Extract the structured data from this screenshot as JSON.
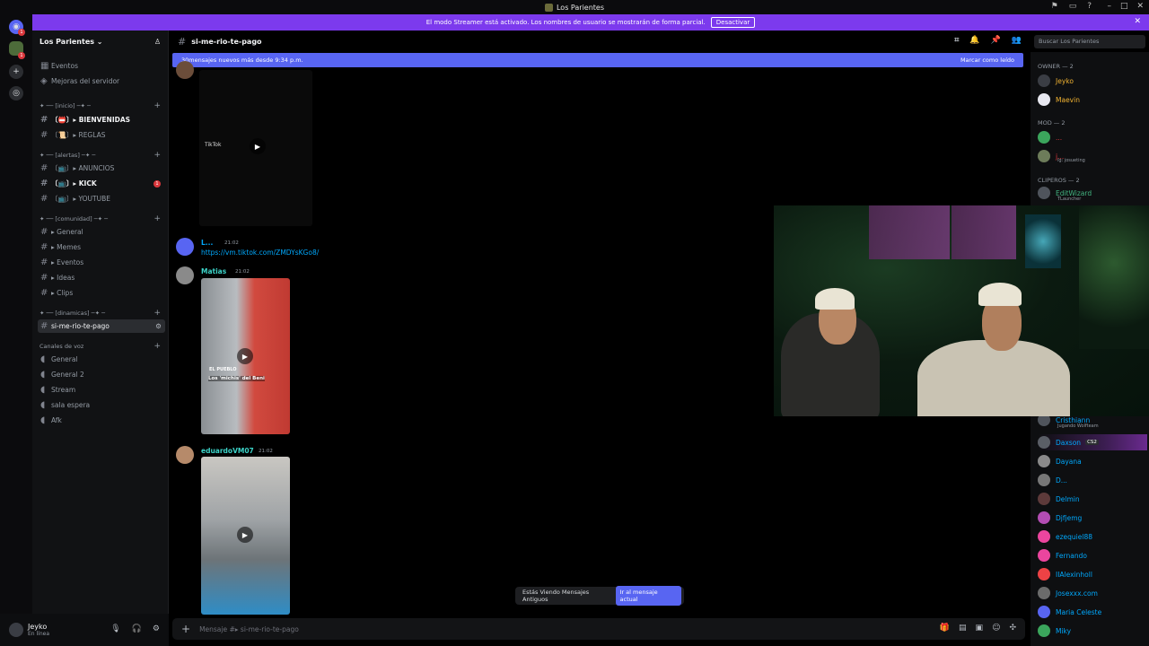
{
  "window": {
    "title": "Los Parientes"
  },
  "banner": {
    "text": "El modo Streamer está activado. Los nombres de usuario se mostrarán de forma parcial.",
    "button": "Desactivar"
  },
  "server": {
    "name": "Los Parientes"
  },
  "channels": {
    "top": [
      "Eventos",
      "Mejoras del servidor"
    ],
    "cat_inicio": "✦ ── [inicio] ─✦ ─",
    "inicio": [
      "〔📛〕▸ BIENVENIDAS",
      "〔📜〕▸ REGLAS"
    ],
    "cat_alertas": "✦ ── [alertas] ─✦ ─",
    "alertas": [
      "〔📺〕▸ ANUNCIOS",
      "〔📺〕▸ KICK",
      "〔📺〕▸ YOUTUBE"
    ],
    "kick_badge": "1",
    "cat_comunidad": "✦ ── [comunidad] ─✦ ─",
    "comunidad": [
      "▸ General",
      "▸ Memes",
      "▸ Eventos",
      "▸ Ideas",
      "▸ Clips"
    ],
    "cat_dinamicas": "✦ ── [dinamicas] ─✦ ─",
    "active": "si-me-rio-te-pago",
    "voice_cat": "Canales de voz",
    "voice": [
      "General",
      "General 2",
      "Stream",
      "sala espera",
      "Afk"
    ]
  },
  "user": {
    "name": "Jeyko",
    "status": "En línea"
  },
  "chat": {
    "channel": "si-me-rio-te-pago",
    "newmsg": "30mensajes nuevos más desde 9:34 p.m.",
    "mark_read": "Marcar como leído",
    "msg1": {
      "name": "L...",
      "time": "21:02",
      "link": "https://vm.tiktok.com/ZMDYsKGo8/"
    },
    "msg2": {
      "name": "Matias",
      "time": "21:02",
      "caption1": "EL PUEBLO",
      "caption2": "Los 'michis' del Beni"
    },
    "msg3": {
      "name": "eduardoVM07",
      "time": "21:02"
    },
    "tiktok": "TikTok",
    "old_banner": "Estás Viendo Mensajes Antiguos",
    "go_current": "Ir al mensaje actual",
    "placeholder": "Mensaje #▸ si-me-rio-te-pago"
  },
  "search_placeholder": "Buscar Los Parientes",
  "members": {
    "owner_cat": "OWNER — 2",
    "owners": [
      "Jeyko",
      "Maevin"
    ],
    "mod_cat": "MOD — 2",
    "mods": [
      "...",
      "j..."
    ],
    "mod_sub": "ig: josueting",
    "clip_cat": "CLIPEROS — 2",
    "clip1": "EditWizard",
    "clip1_sub": "TLauncher",
    "list": [
      "Cristhiann",
      "Daxson",
      "Dayana",
      "D...",
      "Delmin",
      "Djfjemg",
      "ezequiel88",
      "Fernando",
      "IIAlexinholl",
      "Josexxx.com",
      "Maria Celeste",
      "Miky"
    ],
    "cristhiann_sub": "Jugando Wolfteam",
    "daxson_tag": "CS2"
  },
  "colors": {
    "accent": "#5865f2",
    "streamer": "#7c3aed",
    "owner": "#f0b232",
    "mod": "#da373c",
    "clip": "#43b581",
    "member": "#00a8fc"
  }
}
